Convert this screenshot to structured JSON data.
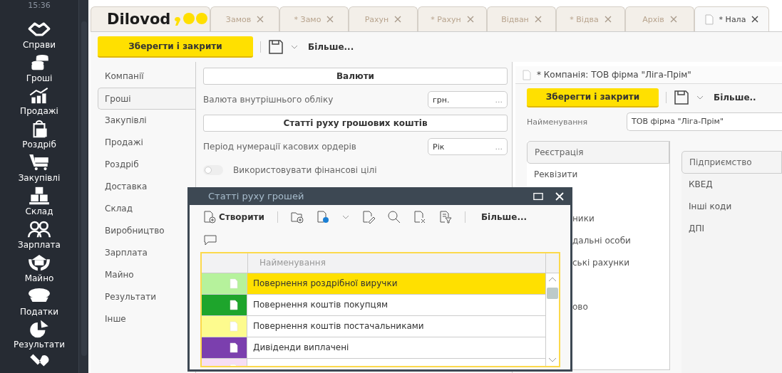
{
  "nav": {
    "time": "15:36",
    "items": [
      {
        "label": "Справи"
      },
      {
        "label": "Гроші"
      },
      {
        "label": "Продажі"
      },
      {
        "label": "Роздріб"
      },
      {
        "label": "Закупівлі"
      },
      {
        "label": "Склад"
      },
      {
        "label": "Зарплата"
      },
      {
        "label": "Майно"
      },
      {
        "label": "Податки"
      },
      {
        "label": "Результати"
      }
    ]
  },
  "logo": {
    "text": "Dilovod"
  },
  "tabs": [
    {
      "label": "Замов",
      "selected": false
    },
    {
      "label": "* Замо",
      "selected": false
    },
    {
      "label": "Рахун",
      "selected": false
    },
    {
      "label": "* Рахун",
      "selected": false
    },
    {
      "label": "Відван",
      "selected": false
    },
    {
      "label": "* Відва",
      "selected": false
    },
    {
      "label": "Архів",
      "selected": false
    },
    {
      "label": "* Нала",
      "selected": true
    }
  ],
  "toolbar": {
    "save": "Зберегти і закрити",
    "more": "Більше..."
  },
  "settings_nav": [
    {
      "label": "Компанії",
      "selected": false
    },
    {
      "label": "Гроші",
      "selected": true
    },
    {
      "label": "Закупівлі",
      "selected": false
    },
    {
      "label": "Продажі",
      "selected": false
    },
    {
      "label": "Роздріб",
      "selected": false
    },
    {
      "label": "Доставка",
      "selected": false
    },
    {
      "label": "Склад",
      "selected": false
    },
    {
      "label": "Виробництво",
      "selected": false
    },
    {
      "label": "Зарплата",
      "selected": false
    },
    {
      "label": "Майно",
      "selected": false
    },
    {
      "label": "Результати",
      "selected": false
    },
    {
      "label": "Інше",
      "selected": false
    }
  ],
  "settings": [
    {
      "kind": "header",
      "label": "Валюти"
    },
    {
      "kind": "field",
      "label": "Валюта внутрішнього обліку",
      "value": "грн.",
      "button": "..."
    },
    {
      "kind": "header",
      "label": "Статті руху грошових коштів"
    },
    {
      "kind": "field",
      "label": "Період нумерації касових ордерів",
      "value": "Рік",
      "button": "..."
    },
    {
      "kind": "toggle",
      "label": "Використовувати фінансові цілі",
      "on": false
    }
  ],
  "company": {
    "title": "* Компанія: ТОВ фірма \"Ліга-Прім\"",
    "save": "Зберегти і закрити",
    "more": "Більше..",
    "name_label": "Найменування",
    "name_value": "ТОВ фірма \"Ліга-Прім\"",
    "left_tab": {
      "label": "Реєстрація"
    },
    "left_items": [
      {
        "label": "Реквізити",
        "kind": "full"
      },
      {
        "label": "ники",
        "kind": "partial-gap"
      },
      {
        "label": "дальні особи",
        "kind": "partial"
      },
      {
        "label": "ські рахунки",
        "kind": "partial"
      },
      {
        "label": "ово",
        "kind": "partial-gap"
      }
    ],
    "right_tab": {
      "label": "Підприємство"
    },
    "right_items": [
      "КВЕД",
      "Інші коди",
      "ДПІ"
    ]
  },
  "dialog": {
    "title": "Статті руху грошей",
    "create": "Створити",
    "more": "Більше...",
    "column": "Найменування",
    "rows": [
      {
        "name": "Повернення роздрібної виручки",
        "color": "#b6f29c",
        "selected": true
      },
      {
        "name": "Повернення коштів покупцям",
        "color": "#1ea52c",
        "selected": false
      },
      {
        "name": "Повернення коштів постачальниками",
        "color": "#fdfb8e",
        "selected": false
      },
      {
        "name": "Дивіденди виплачені",
        "color": "#7b3fae",
        "selected": false
      },
      {
        "color": "#f6def4",
        "selected": false
      }
    ]
  }
}
